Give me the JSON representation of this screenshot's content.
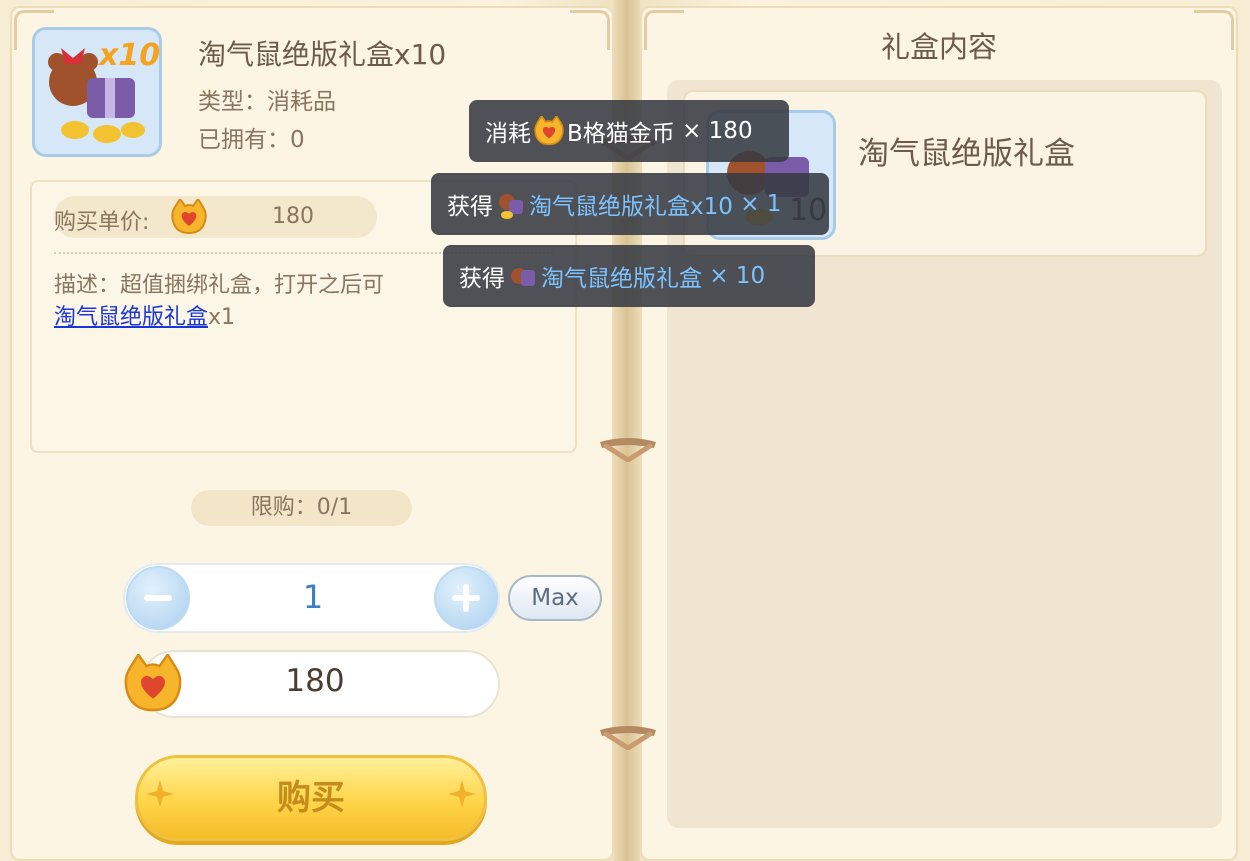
{
  "item": {
    "title": "淘气鼠绝版礼盒x10",
    "type_text": "类型：消耗品",
    "owned_text": "已拥有：0",
    "icon_badge": "x10"
  },
  "price": {
    "label": "购买单价:",
    "value": "180"
  },
  "description": {
    "text": "描述：超值捆绑礼盒，打开之后可",
    "link_text": "淘气鼠绝版礼盒",
    "suffix": "x1"
  },
  "limit_text": "限购：0/1",
  "quantity": {
    "value": "1",
    "max_label": "Max"
  },
  "total": "180",
  "buy_label": "购买",
  "right_page": {
    "title": "礼盒内容",
    "content_name": "淘气鼠绝版礼盒",
    "content_icon_badge": "10"
  },
  "toasts": [
    {
      "prefix": "消耗",
      "item": "B格猫金币",
      "qty": "× 180",
      "blue": false
    },
    {
      "prefix": "获得",
      "item": "淘气鼠绝版礼盒x10",
      "qty": "× 1",
      "blue": true
    },
    {
      "prefix": "获得",
      "item": "淘气鼠绝版礼盒",
      "qty": "× 10",
      "blue": true
    }
  ],
  "icons": {
    "coin": "cat-coin-icon",
    "minus": "minus-icon",
    "plus": "plus-icon",
    "gift": "gift-box-icon"
  },
  "colors": {
    "accent_blue": "#3b7fc4",
    "buy_gold": "#ffd548",
    "link_blue": "#1a36d6",
    "toast_bg": "#373a42"
  }
}
